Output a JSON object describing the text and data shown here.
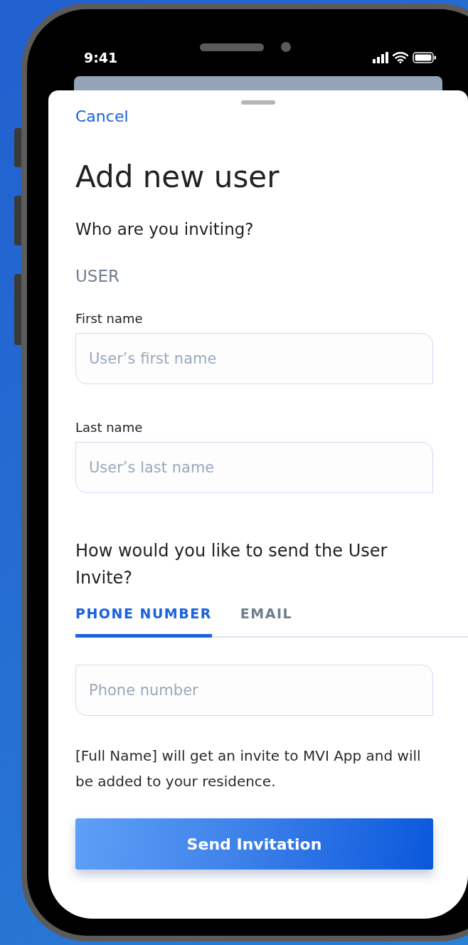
{
  "status_bar": {
    "time": "9:41"
  },
  "sheet": {
    "cancel": "Cancel",
    "title": "Add new user",
    "section": "Who are you inviting?",
    "group": "USER",
    "fields": [
      {
        "label": "First name",
        "placeholder": "User’s first name"
      },
      {
        "label": "Last name",
        "placeholder": "User’s last name"
      }
    ],
    "question": "How would you like to send the User Invite?",
    "tabs": [
      {
        "label": "PHONE NUMBER",
        "selected": true
      },
      {
        "label": "EMAIL",
        "selected": false
      }
    ],
    "contact_field": {
      "placeholder": "Phone number"
    },
    "note": "[Full Name] will get an invite to MVI App and will be added to your residence.",
    "button": "Send Invitation"
  }
}
